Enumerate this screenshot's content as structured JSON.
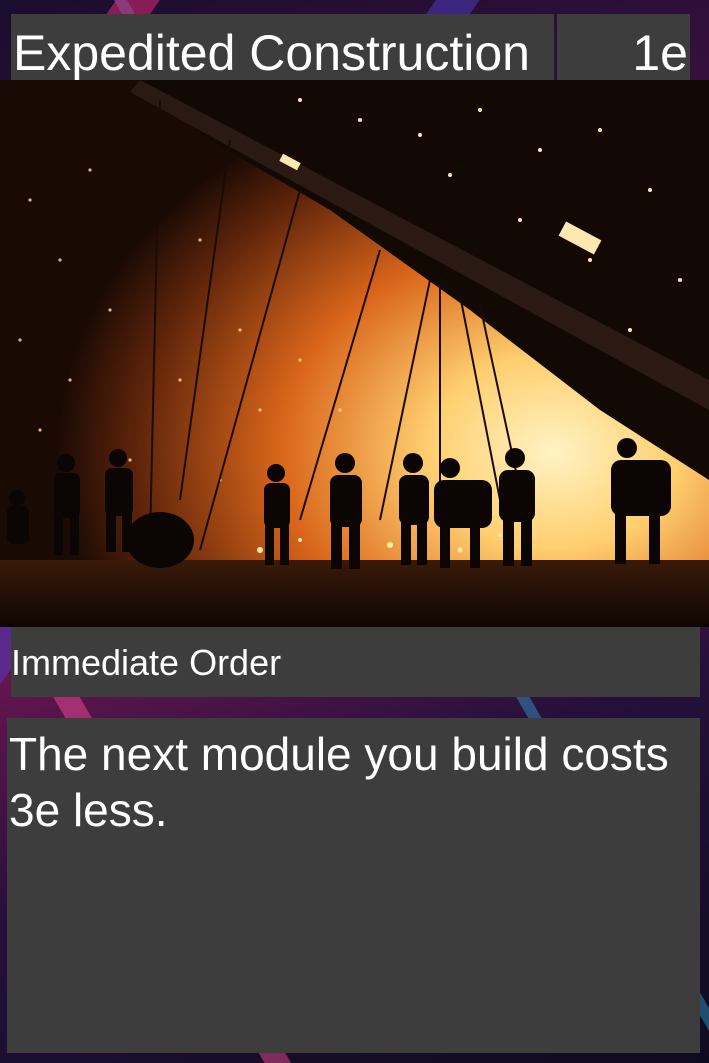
{
  "card": {
    "title": "Expedited Construction",
    "cost": "1e",
    "type_line": "Immediate Order",
    "rules_text": "The next module you build costs 3e less."
  },
  "art": {
    "scene": "silhouetted-workers-welding-in-shipyard",
    "palette": {
      "glow": "#ffd88a",
      "ember": "#e06a1a",
      "dark": "#1a0c05",
      "hull": "#2a1a12"
    }
  },
  "colors": {
    "panel": "#3d3d3d",
    "text": "#ffffff",
    "frame_accent": "#d02a7a"
  }
}
